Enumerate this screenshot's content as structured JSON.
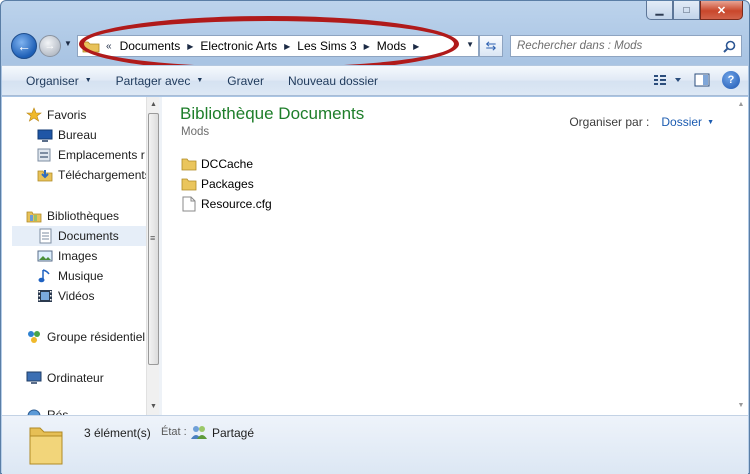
{
  "navbar": {
    "breadcrumb_prefix": "«",
    "breadcrumbs": [
      "Documents",
      "Electronic Arts",
      "Les Sims 3",
      "Mods"
    ],
    "search_placeholder": "Rechercher dans : Mods"
  },
  "toolbar": {
    "organize_label": "Organiser",
    "share_label": "Partager avec",
    "burn_label": "Graver",
    "new_folder_label": "Nouveau dossier"
  },
  "sidebar": {
    "items": [
      {
        "label": "Favoris",
        "icon": "star-icon"
      },
      {
        "label": "Bureau",
        "icon": "desktop-icon"
      },
      {
        "label": "Emplacements ré",
        "icon": "recent-places-icon"
      },
      {
        "label": "Téléchargements",
        "icon": "downloads-icon"
      },
      {
        "label": "Bibliothèques",
        "icon": "libraries-icon"
      },
      {
        "label": "Documents",
        "icon": "documents-icon",
        "selected": true
      },
      {
        "label": "Images",
        "icon": "images-icon"
      },
      {
        "label": "Musique",
        "icon": "music-icon"
      },
      {
        "label": "Vidéos",
        "icon": "videos-icon"
      },
      {
        "label": "Groupe résidentiel",
        "icon": "homegroup-icon"
      },
      {
        "label": "Ordinateur",
        "icon": "computer-icon"
      },
      {
        "label": "Rés",
        "icon": "network-icon"
      }
    ]
  },
  "main": {
    "library_title": "Bibliothèque Documents",
    "library_subtitle": "Mods",
    "arrange_label": "Organiser par :",
    "arrange_value": "Dossier",
    "files": [
      {
        "name": "DCCache",
        "type": "folder"
      },
      {
        "name": "Packages",
        "type": "folder"
      },
      {
        "name": "Resource.cfg",
        "type": "file"
      }
    ]
  },
  "details": {
    "count": "3 élément(s)",
    "state_label": "État :",
    "state_value": "Partagé"
  },
  "colors": {
    "library_title": "#1e7e2a",
    "link": "#1c5cb1",
    "annotation": "#b01a1a"
  }
}
